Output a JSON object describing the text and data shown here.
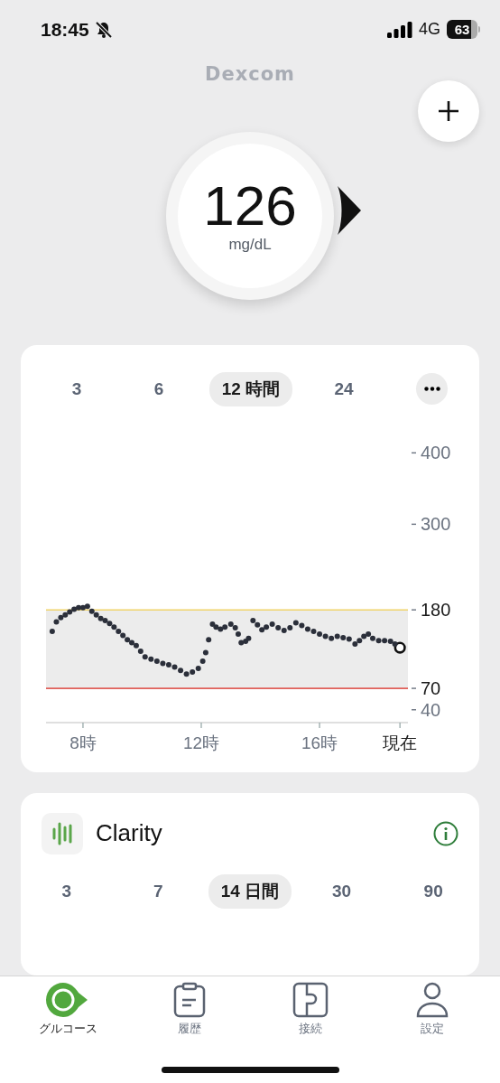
{
  "status_bar": {
    "time": "18:45",
    "network": "4G",
    "battery": "63"
  },
  "brand": "Dexcom",
  "reading": {
    "value": "126",
    "unit": "mg/dL"
  },
  "graph_card": {
    "ranges": [
      {
        "label": "3",
        "selected": false
      },
      {
        "label": "6",
        "selected": false
      },
      {
        "label": "12 時間",
        "selected": true
      },
      {
        "label": "24",
        "selected": false
      }
    ],
    "chart_data": {
      "type": "scatter",
      "xlim": [
        6.75,
        18.99
      ],
      "ylim": [
        22,
        400
      ],
      "xticks": [
        {
          "value": 8,
          "label": "8時"
        },
        {
          "value": 12,
          "label": "12時"
        },
        {
          "value": 16,
          "label": "16時"
        },
        {
          "value": 18.72,
          "label": "現在"
        }
      ],
      "yticks": [
        40,
        70,
        180,
        300,
        400
      ],
      "bands": [
        {
          "axis": "y",
          "from": 70,
          "to": 180,
          "color": "#ececec"
        }
      ],
      "ref_lines": [
        {
          "axis": "y",
          "value": 180,
          "color": "#f0d36a"
        },
        {
          "axis": "y",
          "value": 70,
          "color": "#e0605a"
        }
      ],
      "x": [
        6.96,
        7.1,
        7.25,
        7.4,
        7.55,
        7.7,
        7.85,
        8.0,
        8.15,
        8.3,
        8.45,
        8.6,
        8.75,
        8.9,
        9.05,
        9.2,
        9.35,
        9.5,
        9.65,
        9.8,
        9.95,
        10.1,
        10.3,
        10.5,
        10.7,
        10.9,
        11.1,
        11.3,
        11.5,
        11.7,
        11.9,
        12.05,
        12.15,
        12.25,
        12.38,
        12.5,
        12.65,
        12.8,
        13.0,
        13.15,
        13.25,
        13.35,
        13.5,
        13.6,
        13.75,
        13.9,
        14.05,
        14.2,
        14.4,
        14.6,
        14.8,
        15.0,
        15.2,
        15.4,
        15.6,
        15.8,
        16.0,
        16.2,
        16.4,
        16.6,
        16.8,
        17.0,
        17.2,
        17.35,
        17.5,
        17.65,
        17.8,
        18.0,
        18.2,
        18.4,
        18.55,
        18.72
      ],
      "series": [
        {
          "color": "#111111",
          "values": [
            null,
            null,
            null,
            null,
            null,
            null,
            null,
            null,
            null,
            null,
            null,
            null,
            null,
            null,
            null,
            null,
            null,
            null,
            null,
            null,
            null,
            null,
            null,
            null,
            null,
            null,
            null,
            null,
            null,
            null,
            null,
            null,
            null,
            null,
            null,
            null,
            null,
            null,
            null,
            null,
            null,
            null,
            null,
            null,
            null,
            null,
            null,
            null,
            null,
            null,
            null,
            null,
            null,
            null,
            null,
            null,
            null,
            null,
            null,
            null,
            null,
            null,
            null,
            null,
            null,
            null,
            null,
            null,
            null,
            null,
            null,
            127
          ]
        },
        {
          "color": "#2b2f3a",
          "values": [
            150,
            163,
            169,
            173,
            177,
            181,
            183,
            183,
            185,
            178,
            173,
            168,
            165,
            161,
            156,
            150,
            144,
            138,
            134,
            130,
            122,
            114,
            111,
            108,
            105,
            103,
            100,
            95,
            90,
            93,
            98,
            108,
            120,
            138,
            160,
            156,
            153,
            156,
            160,
            155,
            146,
            134,
            136,
            140,
            165,
            159,
            152,
            156,
            160,
            155,
            151,
            155,
            162,
            158,
            153,
            150,
            146,
            143,
            140,
            143,
            141,
            139,
            132,
            137,
            143,
            146,
            140,
            137,
            137,
            136,
            132,
            null
          ]
        }
      ]
    }
  },
  "clarity_card": {
    "title": "Clarity",
    "ranges": [
      {
        "label": "3",
        "selected": false
      },
      {
        "label": "7",
        "selected": false
      },
      {
        "label": "14 日間",
        "selected": true
      },
      {
        "label": "30",
        "selected": false
      },
      {
        "label": "90",
        "selected": false
      }
    ]
  },
  "tab_bar": [
    {
      "kind": "glucose",
      "label": "グルコース",
      "selected": true
    },
    {
      "kind": "history",
      "label": "履歴",
      "selected": false
    },
    {
      "kind": "connection",
      "label": "接続",
      "selected": false
    },
    {
      "kind": "settings",
      "label": "設定",
      "selected": false
    }
  ]
}
